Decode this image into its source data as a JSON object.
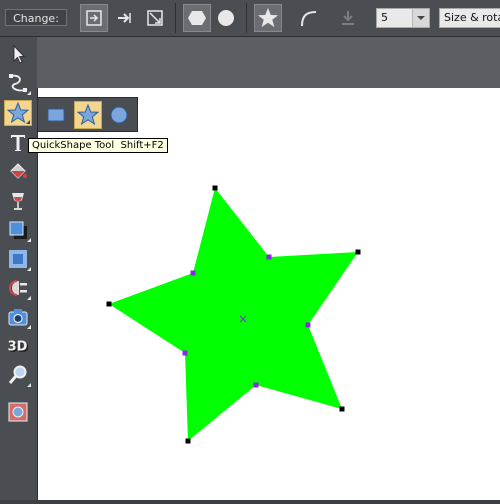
{
  "infobar": {
    "change_label": "Change:",
    "value": "5",
    "mode": "Size & rotation"
  },
  "tooltip": {
    "text": "QuickShape Tool  Shift+F2"
  },
  "colors": {
    "shape_fill": "#00ff00",
    "tool_highlight": "#f2d58f",
    "toolbar_bg": "#4a4d52",
    "canvas_bg": "#ffffff"
  },
  "toolbar": {
    "tools": [
      "selector-tool",
      "shape-editor-tool",
      "quickshape-tool",
      "text-tool",
      "fill-tool",
      "transparency-tool",
      "shadow-tool",
      "bevel-tool",
      "blend-tool",
      "photo-tool",
      "extrude-tool",
      "zoom-tool",
      "live-effects-tool"
    ]
  },
  "canvas": {
    "shape": "star",
    "points": 5,
    "selected": true
  }
}
